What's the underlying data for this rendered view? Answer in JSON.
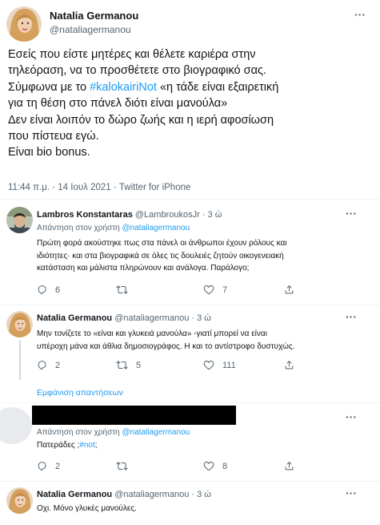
{
  "main_tweet": {
    "name": "Natalia Germanou",
    "handle": "@nataliagermanou",
    "text_lines": [
      "Εσείς που είστε μητέρες και θέλετε καριέρα στην",
      "τηλεόραση, να το προσθέτετε στο βιογραφικό σας.",
      "Σύμφωνα με το ",
      "#kalokairiNot",
      " «η τάδε είναι εξαιρετική",
      "για τη θέση στο πάνελ διότι είναι μανούλα»",
      "Δεν είναι λοιπόν το δώρο ζωής και η ιερή αφοσίωση",
      "που πίστευα εγώ.",
      "Είναι bio bonus."
    ],
    "timestamp": "11:44 π.μ. · 14 Ιουλ 2021 · Twitter for iPhone"
  },
  "replies": [
    {
      "name": "Lambros Konstantaras",
      "handle": "@LambroukosJr",
      "time": "· 3 ώ",
      "replying_prefix": "Απάντηση στον χρήστη ",
      "replying_to": "@nataliagermanou",
      "text_lines": [
        "Πρώτη φορά ακούστηκε πως στα πάνελ οι άνθρωποι έχουν ρόλους και",
        "ιδιότητες· και στα  βιογραφικά σε όλες τις δουλειές ζητούν οικογενειακή",
        "κατάσταση και μάλιστα πληρώνουν και ανάλογα. Παράλογο;"
      ],
      "replies_count": "6",
      "retweets_count": "",
      "likes_count": "7"
    },
    {
      "name": "Natalia Germanou",
      "handle": "@nataliagermanou",
      "time": "· 3 ώ",
      "text_lines": [
        "Μην τονίζετε το «είναι και γλυκειά μανούλα» -γιατί μπορεί να είναι",
        "υπέροχη μάνα και άθλια δημοσιογράφος. Η και το αντίστροφο δυστυχώς."
      ],
      "replies_count": "2",
      "retweets_count": "5",
      "likes_count": "111"
    },
    {
      "show_replies": "Εμφάνιση απαντήσεων"
    },
    {
      "replying_prefix": "Απάντηση στον χρήστη ",
      "replying_to": "@nataliagermanou",
      "text_prefix": "Πατεράδες ;",
      "hashtag": "#not",
      "text_suffix": ";",
      "replies_count": "2",
      "retweets_count": "",
      "likes_count": "8"
    },
    {
      "name": "Natalia Germanou",
      "handle": "@nataliagermanou",
      "time": "· 3 ώ",
      "text": "Οχι. Μόνο γλυκές μανούλες."
    }
  ],
  "colors": {
    "link": "#1d9bf0",
    "text": "#0f1419",
    "secondary": "#536471",
    "divider": "#eff3f4",
    "redaction": "#000000"
  }
}
